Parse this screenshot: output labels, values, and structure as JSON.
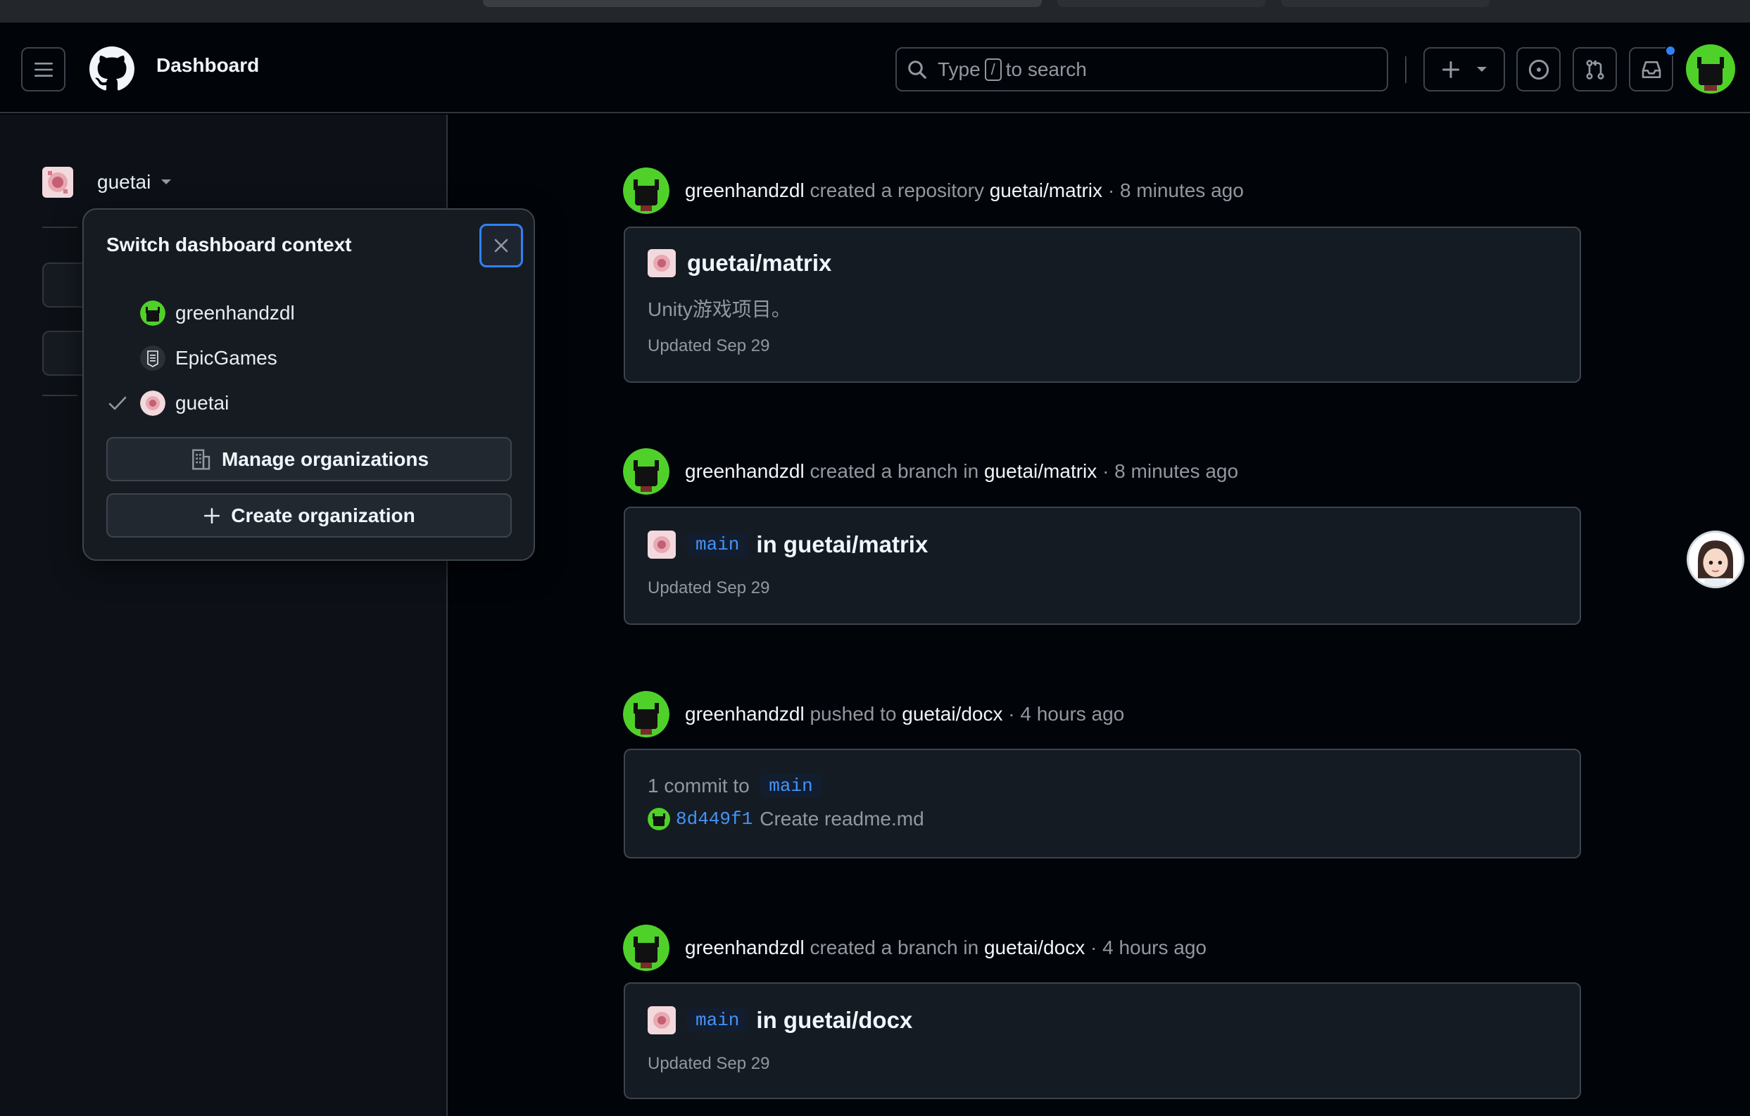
{
  "header": {
    "title": "Dashboard",
    "search": {
      "prefix": "Type",
      "key": "/",
      "suffix": "to search"
    }
  },
  "sidebar": {
    "context_name": "guetai"
  },
  "popover": {
    "title": "Switch dashboard context",
    "contexts": [
      {
        "name": "greenhandzdl",
        "selected": false
      },
      {
        "name": "EpicGames",
        "selected": false
      },
      {
        "name": "guetai",
        "selected": true
      }
    ],
    "manage_label": "Manage organizations",
    "create_label": "Create organization"
  },
  "feed": [
    {
      "actor": "greenhandzdl",
      "action": "created a repository",
      "target": "guetai/matrix",
      "time": "· 8 minutes ago",
      "card": {
        "title": "guetai/matrix",
        "description": "Unity游戏项目。",
        "updated": "Updated Sep 29"
      }
    },
    {
      "actor": "greenhandzdl",
      "action": "created a branch in",
      "target": "guetai/matrix",
      "time": "· 8 minutes ago",
      "card": {
        "branch": "main",
        "title": "in guetai/matrix",
        "updated": "Updated Sep 29"
      }
    },
    {
      "actor": "greenhandzdl",
      "action": "pushed to",
      "target": "guetai/docx",
      "time": "· 4 hours ago",
      "card": {
        "commit_summary": "1 commit to",
        "branch": "main",
        "sha": "8d449f1",
        "message": "Create readme.md"
      }
    },
    {
      "actor": "greenhandzdl",
      "action": "created a branch in",
      "target": "guetai/docx",
      "time": "· 4 hours ago",
      "card": {
        "branch": "main",
        "title": "in guetai/docx",
        "updated": "Updated Sep 29"
      }
    }
  ],
  "icons": {
    "menu": "hamburger-icon",
    "logo": "github-logo-icon",
    "search": "search-icon",
    "plus": "plus-icon",
    "issues": "issue-opened-icon",
    "pulls": "git-pull-request-icon",
    "inbox": "inbox-icon",
    "close": "close-icon",
    "check": "check-icon",
    "org": "organization-icon"
  },
  "colors": {
    "accent": "#2f81f7",
    "link": "#4493f8",
    "avatar_green": "#4fd12a",
    "background": "#010409",
    "sidebar": "#0d1117",
    "card": "#151b23"
  }
}
